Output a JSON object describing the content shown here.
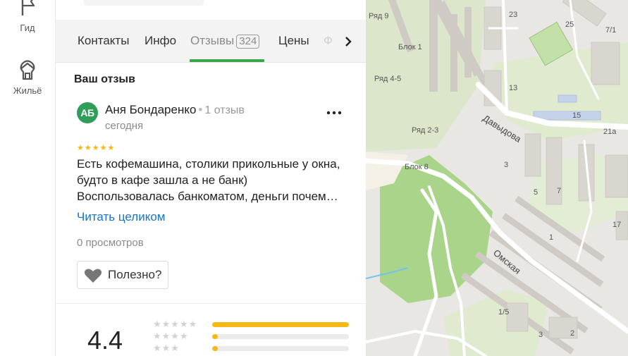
{
  "rail": {
    "guide_label": "Гид",
    "housing_label": "Жильё"
  },
  "tabs": {
    "contacts": "Контакты",
    "info": "Инфо",
    "reviews": "Отзывы",
    "reviews_count": "324",
    "prices": "Цены",
    "photo": "Ф"
  },
  "section_title": "Ваш отзыв",
  "review": {
    "avatar_initials": "АБ",
    "author": "Аня Бондаренко",
    "author_reviews": "1 отзыв",
    "date": "сегодня",
    "stars": "★★★★★",
    "rating": 5,
    "text": "Есть кофемашина, столики прикольные у окна, будто в кафе зашла а не банк) Воспользовалась банкоматом, деньги почем…",
    "read_more": "Читать целиком",
    "views": "0 просмотров",
    "helpful": "Полезно?"
  },
  "summary": {
    "rating": "4.4",
    "distribution": [
      {
        "stars": "★★★★★",
        "level": 1.0
      },
      {
        "stars": "★★★★",
        "level": 0.04
      },
      {
        "stars": "★★★",
        "level": 0.04
      }
    ]
  },
  "map": {
    "labels": {
      "row9": "Ряд 9",
      "block1": "Блок 1",
      "row45": "Ряд 4-5",
      "row23": "Ряд 2-3",
      "block8": "Блок 8",
      "street_davydova": "Давыдова",
      "street_omskaya": "Омская",
      "b23": "23",
      "b25": "25",
      "b71": "7/1",
      "b13": "13",
      "b15": "15",
      "b21a": "21а",
      "b3": "3",
      "b5": "5",
      "b7": "7",
      "b17": "17",
      "b1": "1",
      "b15b": "1/5",
      "b2": "2",
      "b3b": "3"
    },
    "colors": {
      "base": "#e9e7e3",
      "green": "#cfe6b8",
      "park": "#a9d48a",
      "road": "#ffffff",
      "building": "#d9d6d0",
      "water": "#73c4e8"
    }
  }
}
